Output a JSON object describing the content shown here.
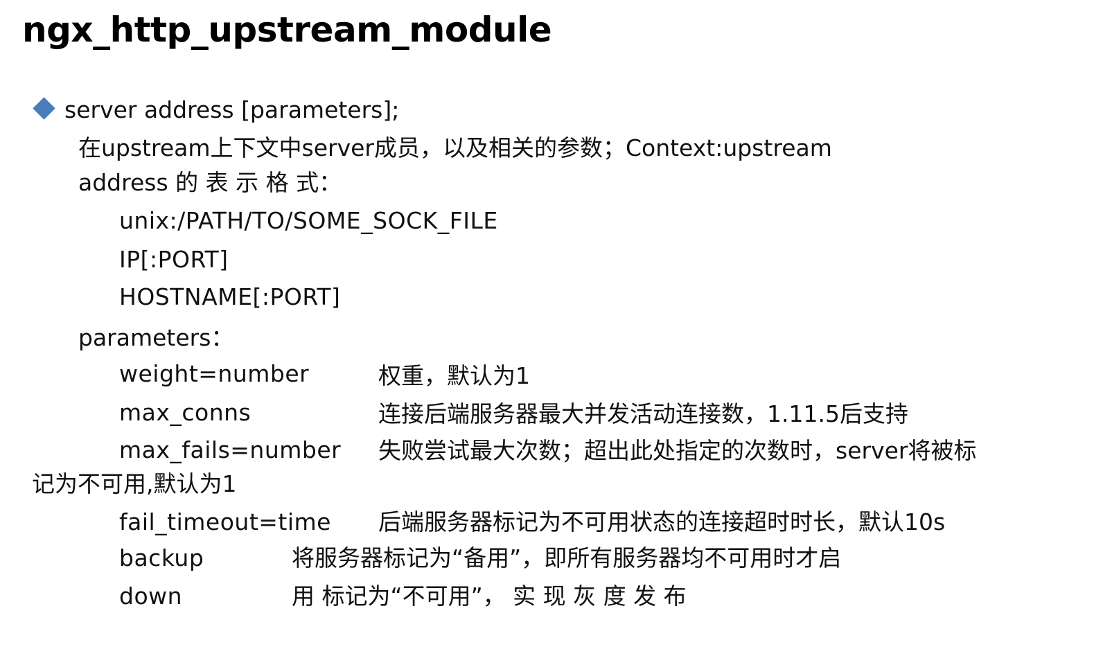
{
  "title": "ngx_http_upstream_module",
  "bullet": {
    "icon": "diamond-bullet-icon",
    "color": "#4a7ebb",
    "text": "server address [parameters];"
  },
  "intro": "在upstream上下文中server成员，以及相关的参数；Context:upstream",
  "address": {
    "heading": "address 的 表 示 格 式：",
    "formats": [
      "unix:/PATH/TO/SOME_SOCK_FILE",
      "IP[:PORT]",
      "HOSTNAME[:PORT]"
    ]
  },
  "parameters": {
    "heading": "parameters：",
    "items": [
      {
        "name": "weight=number",
        "desc": "权重，默认为1"
      },
      {
        "name": "max_conns",
        "desc": "连接后端服务器最大并发活动连接数，1.11.5后支持"
      },
      {
        "name": "max_fails=number",
        "desc": "失败尝试最大次数；超出此处指定的次数时，server将被标",
        "desc_cont": "记为不可用,默认为1"
      },
      {
        "name": "fail_timeout=time",
        "desc": "后端服务器标记为不可用状态的连接超时时长，默认10s"
      },
      {
        "name": "backup",
        "desc": "将服务器标记为“备用”，即所有服务器均不可用时才启"
      },
      {
        "name": "down",
        "desc": "用 标记为“不可用”， 实 现 灰 度 发 布"
      }
    ]
  }
}
